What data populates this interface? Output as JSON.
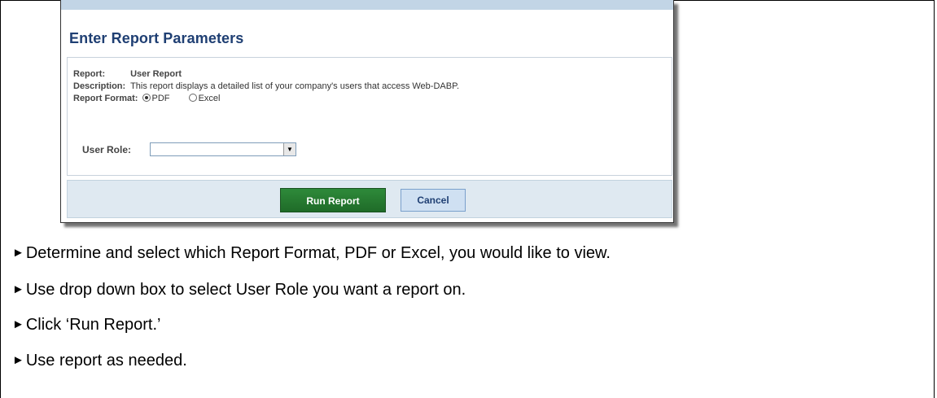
{
  "panel": {
    "title": "Enter Report Parameters",
    "report_label": "Report:",
    "report_value": "User Report",
    "description_label": "Description:",
    "description_value": "This report displays a detailed list of your company's users that access Web-DABP.",
    "format_label": "Report Format:",
    "format_options": [
      {
        "label": "PDF",
        "selected": true
      },
      {
        "label": "Excel",
        "selected": false
      }
    ],
    "user_role_label": "User Role:",
    "user_role_value": "",
    "run_button": "Run Report",
    "cancel_button": "Cancel"
  },
  "instructions": {
    "bullet": "►",
    "items": [
      "Determine and select which Report Format, PDF or Excel, you would like to view.",
      "Use drop down box to select User Role you want a report on.",
      "Click ‘Run Report.’",
      "Use report as needed."
    ]
  },
  "colors": {
    "title": "#1f3f73",
    "run_button": "#1f6b28",
    "cancel_button": "#cfe0f2",
    "button_bar": "#dfe9f1"
  }
}
